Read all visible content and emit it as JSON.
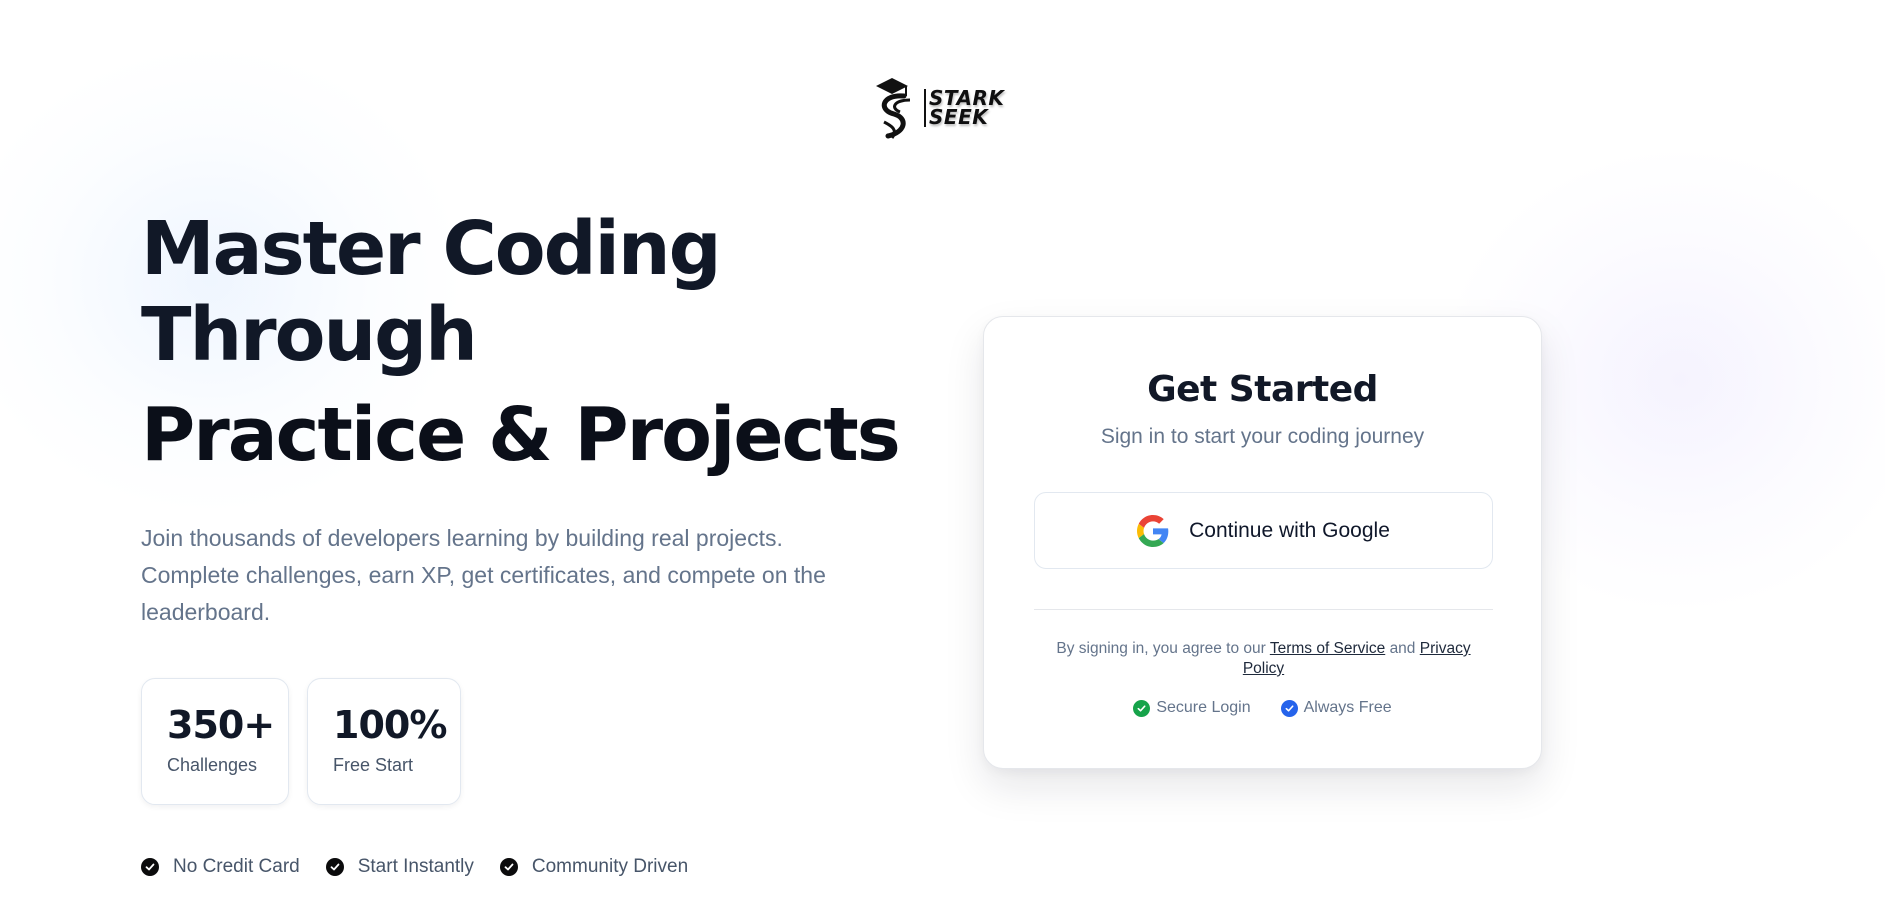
{
  "logo": {
    "line1": "STARK",
    "line2": "SEEK"
  },
  "hero": {
    "title_line1": "Master Coding",
    "title_line2": "Through",
    "title_line3": "Practice & Projects",
    "description": "Join thousands of developers learning by building real projects. Complete challenges, earn XP, get certificates, and compete on the leaderboard."
  },
  "stats": [
    {
      "value": "350+",
      "label": "Challenges"
    },
    {
      "value": "100%",
      "label": "Free Start"
    }
  ],
  "features": [
    "No Credit Card",
    "Start Instantly",
    "Community Driven"
  ],
  "signin_card": {
    "title": "Get Started",
    "subtitle": "Sign in to start your coding journey",
    "google_button": "Continue with Google",
    "legal_prefix": "By signing in, you agree to our",
    "terms_link": "Terms of Service",
    "legal_and": "and",
    "privacy_link": "Privacy Policy",
    "badges": [
      {
        "label": "Secure Login",
        "color": "#16a34a",
        "icon": "check-circle-icon"
      },
      {
        "label": "Always Free",
        "color": "#2563eb",
        "icon": "check-circle-icon"
      }
    ]
  },
  "colors": {
    "heading": "#111827",
    "muted_text": "#64748b",
    "secure_green": "#16a34a",
    "free_blue": "#2563eb"
  }
}
